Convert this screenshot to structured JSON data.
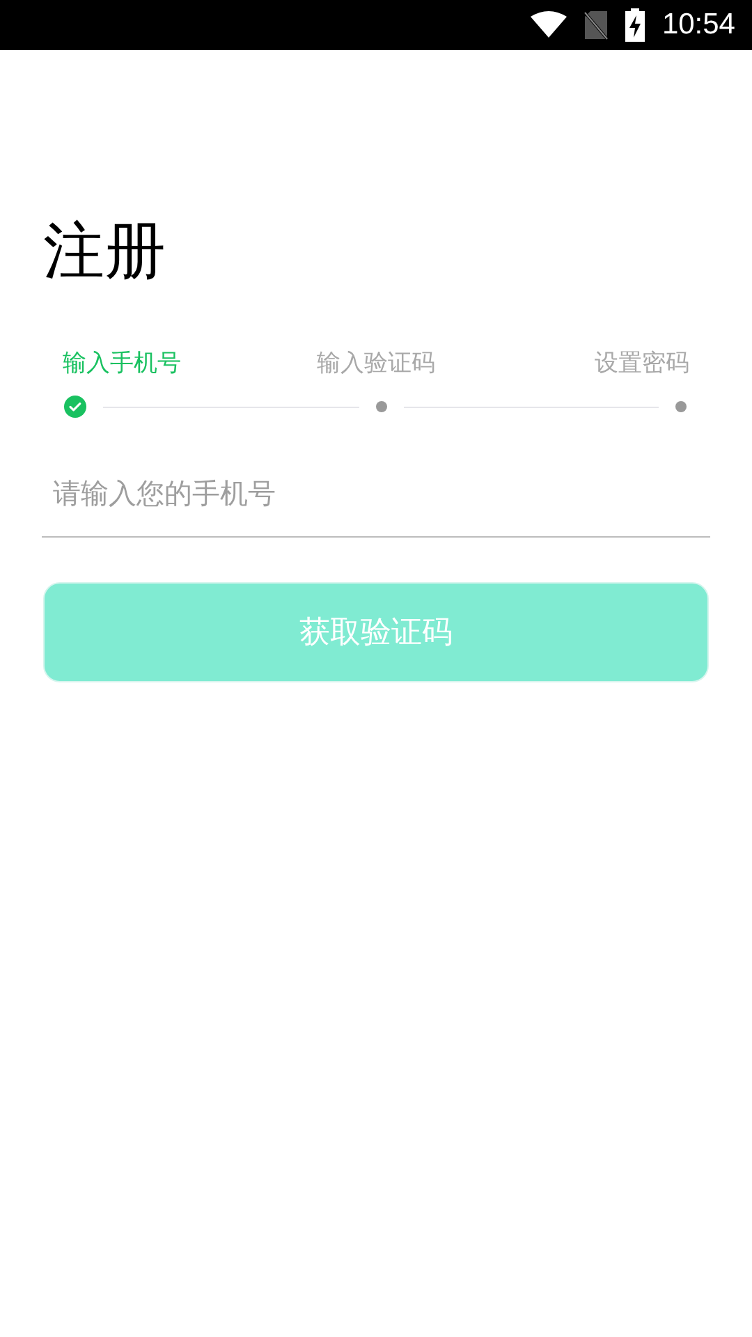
{
  "status_bar": {
    "time": "10:54"
  },
  "title": "注册",
  "steps": [
    {
      "label": "输入手机号",
      "selected": true
    },
    {
      "label": "输入验证码",
      "selected": false
    },
    {
      "label": "设置密码",
      "selected": false
    }
  ],
  "phone_field": {
    "placeholder": "请输入您的手机号"
  },
  "submit_button": {
    "label": "获取验证码",
    "disabled": true
  }
}
